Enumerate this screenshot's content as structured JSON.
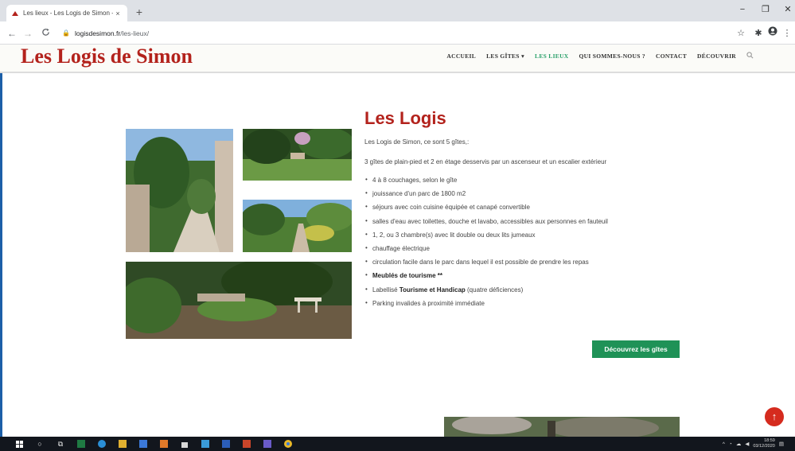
{
  "browser": {
    "tab_title": "Les lieux - Les Logis de Simon - L",
    "tab_close": "×",
    "new_tab": "+",
    "url_host": "logisdesimon.fr",
    "url_path": "/les-lieux/",
    "window_controls": [
      "−",
      "❐",
      "✕"
    ]
  },
  "site": {
    "logo": "Les Logis de Simon",
    "nav": [
      "ACCUEIL",
      "LES GÎTES ▾",
      "LES LIEUX",
      "QUI SOMMES-NOUS ?",
      "CONTACT",
      "DÉCOUVRIR"
    ],
    "active_nav": "LES LIEUX"
  },
  "main": {
    "heading": "Les Logis",
    "intro": "Les Logis de Simon, ce sont 5 gîtes,:",
    "paragraph": "3 gîtes de plain-pied et 2 en étage desservis par un ascenseur et un escalier extérieur",
    "features": [
      {
        "text": "4 à 8 couchages, selon le gîte"
      },
      {
        "text": "jouissance d'un parc de 1800 m2"
      },
      {
        "text": "séjours avec coin cuisine équipée et canapé convertible"
      },
      {
        "text": "salles d'eau avec toilettes, douche et lavabo, accessibles aux personnes en fauteuil"
      },
      {
        "text": "1, 2, ou 3 chambre(s) avec lit double ou deux lits jumeaux"
      },
      {
        "text": "chauffage électrique"
      },
      {
        "text": "circulation facile dans le parc dans lequel il est possible de prendre les repas"
      },
      {
        "bold": "Meublés de tourisme **"
      },
      {
        "pre": "Labellisé ",
        "bold": "Tourisme et Handicap",
        "post": " (quatre déficiences)"
      },
      {
        "text": "Parking invalides à proximité immédiate"
      }
    ],
    "cta_label": "Découvrez les gîtes",
    "back_to_top": "↑"
  },
  "taskbar": {
    "time": "18:59",
    "date": "03/12/2020"
  },
  "colors": {
    "brand_red": "#b3221c",
    "active_green": "#2aa06a",
    "cta_green": "#1f9257"
  }
}
